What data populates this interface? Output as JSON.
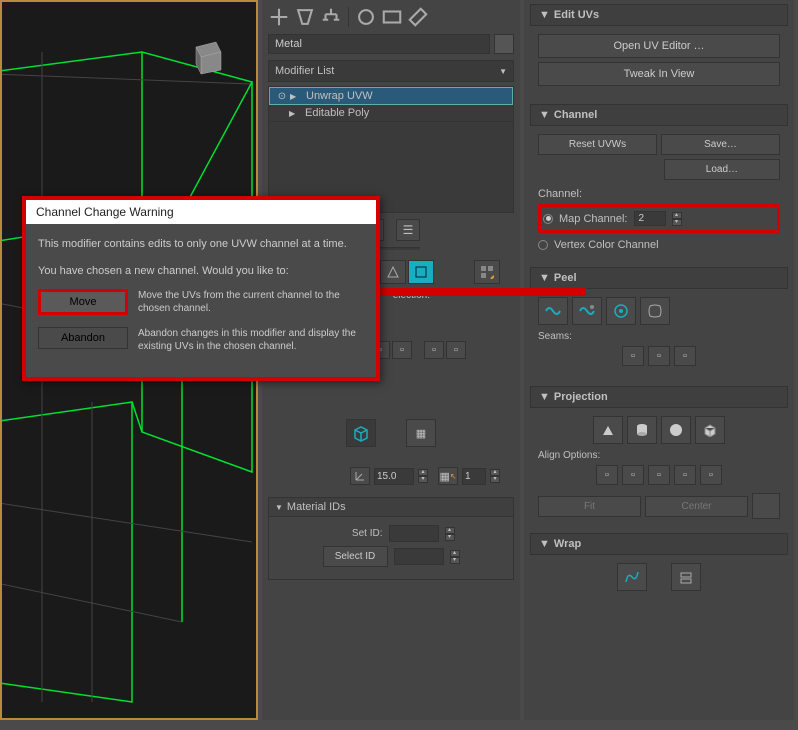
{
  "viewport": {
    "active": true
  },
  "toolbar": {
    "object_name": "Metal"
  },
  "modifier": {
    "list_label": "Modifier List",
    "stack": [
      {
        "name": "Unwrap UVW",
        "active": true
      },
      {
        "name": "Editable Poly",
        "active": false
      }
    ]
  },
  "edit_section": {
    "selection_label": "election:",
    "angle_value": "15.0",
    "stitch_value": "1"
  },
  "material_ids": {
    "title": "Material IDs",
    "set_id_label": "Set ID:",
    "set_id_value": "",
    "select_id_label": "Select ID",
    "select_id_value": ""
  },
  "edit_uvs": {
    "title": "Edit UVs",
    "open_editor": "Open UV Editor …",
    "tweak": "Tweak In View"
  },
  "channel": {
    "title": "Channel",
    "reset": "Reset UVWs",
    "save": "Save…",
    "load": "Load…",
    "channel_label": "Channel:",
    "map_channel_label": "Map Channel:",
    "map_channel_value": "2",
    "vertex_color_label": "Vertex Color Channel"
  },
  "peel": {
    "title": "Peel",
    "seams_label": "Seams:"
  },
  "projection": {
    "title": "Projection",
    "align_label": "Align Options:",
    "fit": "Fit",
    "center": "Center"
  },
  "wrap": {
    "title": "Wrap"
  },
  "dialog": {
    "title": "Channel Change Warning",
    "line1": "This modifier contains edits to only one UVW channel at a time.",
    "line2": "You have chosen a new channel. Would you like to:",
    "move_btn": "Move",
    "move_desc": "Move the UVs from the current channel to the chosen channel.",
    "abandon_btn": "Abandon",
    "abandon_desc": "Abandon changes in this modifier and display the existing UVs in the chosen channel."
  }
}
